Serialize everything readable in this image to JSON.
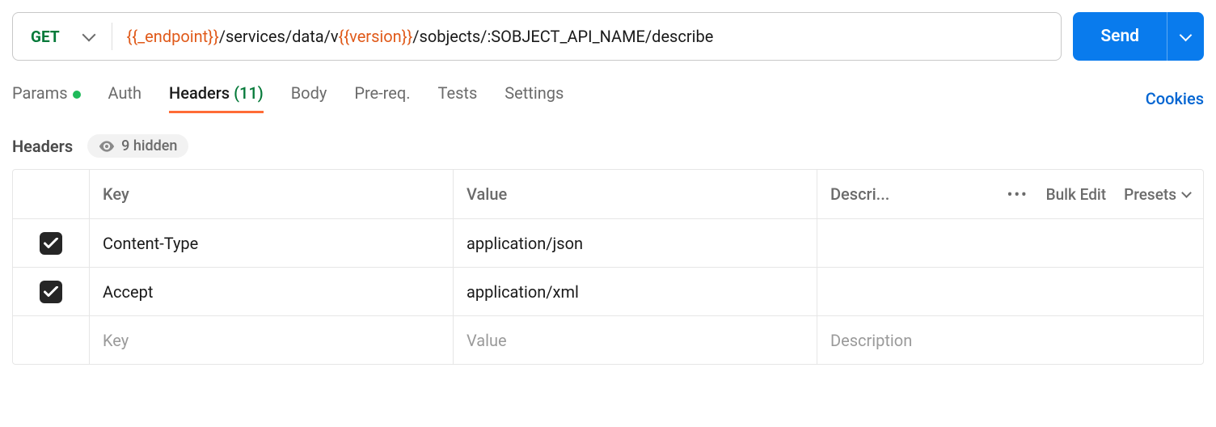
{
  "request": {
    "method": "GET",
    "url_parts": {
      "var1": "{{_endpoint}}",
      "seg1": "/services/data/v",
      "var2": "{{version}}",
      "seg2": "/sobjects/:SOBJECT_API_NAME/describe"
    },
    "send_label": "Send"
  },
  "tabs": {
    "params": "Params",
    "auth": "Auth",
    "headers": "Headers",
    "headers_count": "(11)",
    "body": "Body",
    "prereq": "Pre-req.",
    "tests": "Tests",
    "settings": "Settings"
  },
  "cookies_label": "Cookies",
  "section": {
    "title": "Headers",
    "hidden_label": "9 hidden"
  },
  "table": {
    "col_key": "Key",
    "col_value": "Value",
    "col_desc": "Descri...",
    "bulk_edit": "Bulk Edit",
    "presets": "Presets",
    "rows": [
      {
        "key": "Content-Type",
        "value": "application/json"
      },
      {
        "key": "Accept",
        "value": "application/xml"
      }
    ],
    "placeholder_key": "Key",
    "placeholder_value": "Value",
    "placeholder_desc": "Description"
  }
}
